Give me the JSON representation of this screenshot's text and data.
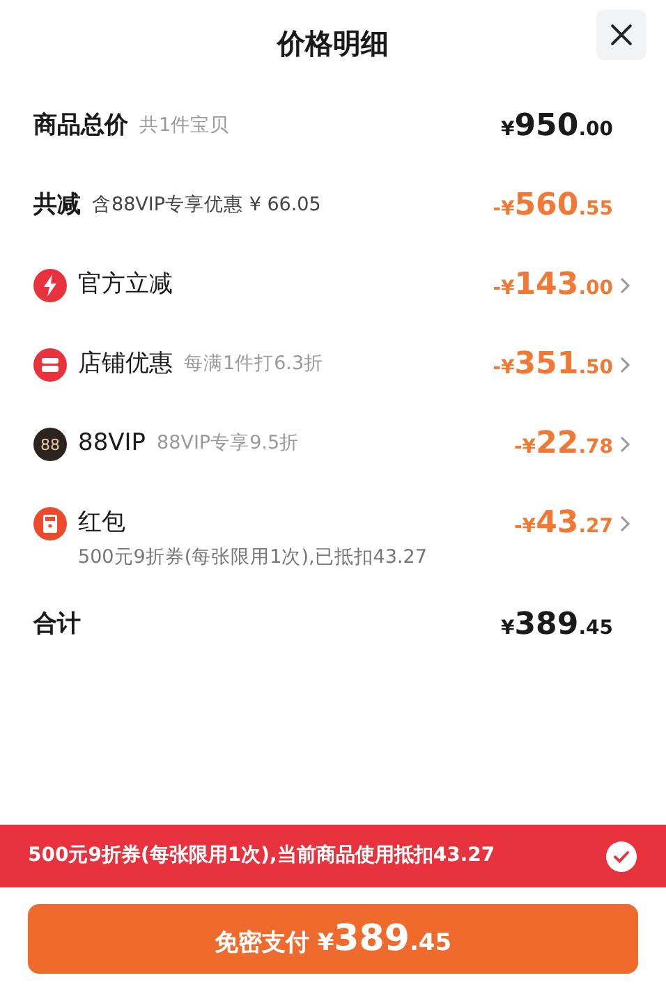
{
  "title": "价格明细",
  "rows": [
    {
      "kind": "summary",
      "label": "商品总价",
      "note": "共1件宝贝",
      "amount": "¥950.00",
      "accent": false
    },
    {
      "kind": "summary",
      "label": "共减",
      "note": "含88VIP专享优惠 ¥ 66.05",
      "amount": "-¥560.55",
      "accent": true
    },
    {
      "kind": "instant",
      "label": "官方立减",
      "amount": "-¥143.00",
      "accent": true
    },
    {
      "kind": "shop",
      "label": "店铺优惠",
      "note": "每满1件打6.3折",
      "amount": "-¥351.50",
      "accent": true
    },
    {
      "kind": "vip",
      "icon_text": "88",
      "label": "88VIP",
      "note": "88VIP专享9.5折",
      "amount": "-¥22.78",
      "accent": true
    },
    {
      "kind": "coupon",
      "label": "红包",
      "amount": "-¥43.27",
      "accent": true,
      "subnote": "500元9折券(每张限用1次),已抵扣43.27"
    },
    {
      "kind": "summary",
      "label": "合计",
      "amount": "¥389.45",
      "accent": false
    }
  ],
  "coupon_banner": {
    "text": "500元9折券(每张限用1次),当前商品使用抵扣43.27",
    "checked": true
  },
  "pay_button": {
    "label": "免密支付",
    "amount": "¥389.45"
  }
}
